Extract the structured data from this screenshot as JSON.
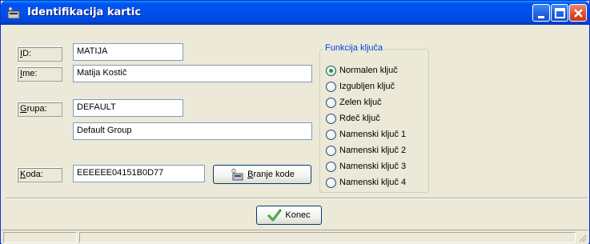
{
  "window": {
    "title": "Identifikacija kartic",
    "controls": {
      "minimize": "minimize-icon",
      "maximize": "maximize-icon",
      "close": "close-icon"
    }
  },
  "form": {
    "id_label_u": "I",
    "id_label_rest": "D:",
    "id_value": "MATIJA",
    "ime_label_u": "I",
    "ime_label_rest": "me:",
    "ime_value": "Matija Kostič",
    "grupa_label_u": "G",
    "grupa_label_rest": "rupa:",
    "grupa_value": "DEFAULT",
    "grupa_desc": "Default Group",
    "koda_label_u": "K",
    "koda_label_rest": "oda:",
    "koda_value": "EEEEEE04151B0D77",
    "read_button_u": "B",
    "read_button_rest": "ranje kode"
  },
  "funkcija": {
    "title": "Funkcija ključa",
    "options": [
      {
        "label": "Normalen ključ",
        "selected": true
      },
      {
        "label": "Izgubljen ključ",
        "selected": false
      },
      {
        "label": "Zelen ključ",
        "selected": false
      },
      {
        "label": "Rdeč  ključ",
        "selected": false
      },
      {
        "label": "Namenski ključ 1",
        "selected": false
      },
      {
        "label": "Namenski ključ 2",
        "selected": false
      },
      {
        "label": "Namenski ključ 3",
        "selected": false
      },
      {
        "label": "Namenski ključ 4",
        "selected": false
      }
    ]
  },
  "footer": {
    "close_button": "Konec"
  },
  "colors": {
    "titlebar": "#0050ee",
    "group_title": "#0046d5",
    "window_bg": "#ece9d8"
  }
}
